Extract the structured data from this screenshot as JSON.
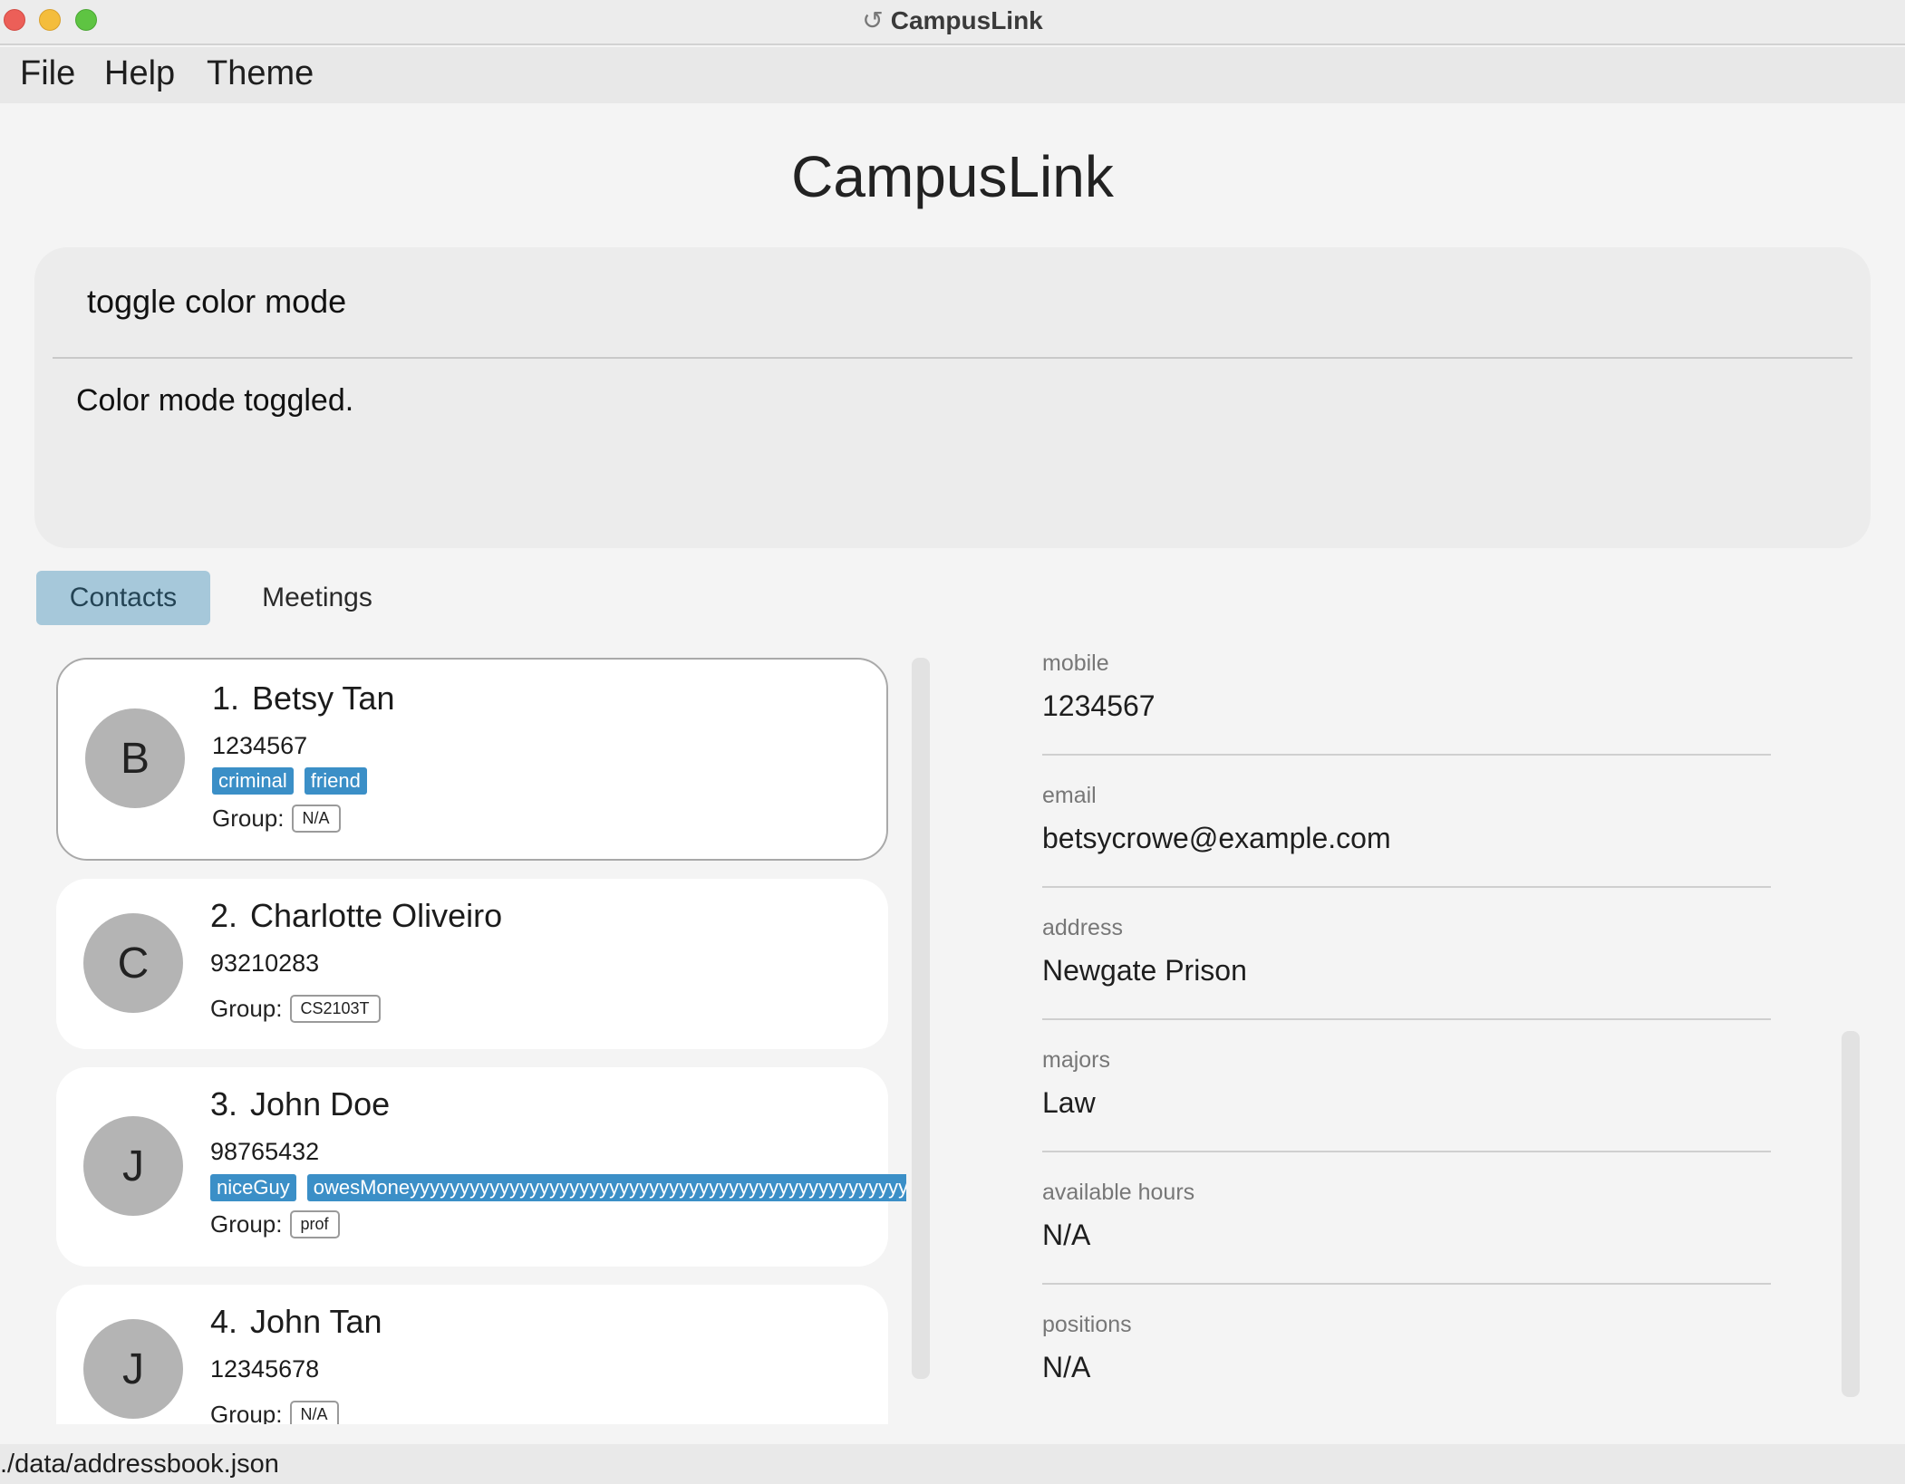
{
  "window": {
    "title": "CampusLink",
    "app_icon": "campuslink-icon"
  },
  "menubar": {
    "items": [
      "File",
      "Help",
      "Theme"
    ]
  },
  "app": {
    "heading": "CampusLink"
  },
  "command": {
    "input_value": "toggle color mode",
    "result": "Color mode toggled."
  },
  "tabs": [
    {
      "label": "Contacts",
      "active": true
    },
    {
      "label": "Meetings",
      "active": false
    }
  ],
  "contacts": [
    {
      "index": "1.",
      "name": "Betsy Tan",
      "initial": "B",
      "phone": "1234567",
      "tags": [
        "criminal",
        "friend"
      ],
      "group_label": "Group:",
      "group": "N/A"
    },
    {
      "index": "2.",
      "name": "Charlotte Oliveiro",
      "initial": "C",
      "phone": "93210283",
      "tags": [],
      "group_label": "Group:",
      "group": "CS2103T"
    },
    {
      "index": "3.",
      "name": "John Doe",
      "initial": "J",
      "phone": "98765432",
      "tags": [
        "niceGuy",
        "owesMoneyyyyyyyyyyyyyyyyyyyyyyyyyyyyyyyyyyyyyyyyyyyyyyyyyy"
      ],
      "group_label": "Group:",
      "group": "prof"
    },
    {
      "index": "4.",
      "name": "John Tan",
      "initial": "J",
      "phone": "12345678",
      "tags": [],
      "group_label": "Group:",
      "group": "N/A"
    }
  ],
  "details": [
    {
      "label": "mobile",
      "value": "1234567"
    },
    {
      "label": "email",
      "value": "betsycrowe@example.com"
    },
    {
      "label": "address",
      "value": "Newgate Prison"
    },
    {
      "label": "majors",
      "value": "Law"
    },
    {
      "label": "available hours",
      "value": "N/A"
    },
    {
      "label": "positions",
      "value": "N/A"
    }
  ],
  "statusbar": {
    "path": "./data/addressbook.json"
  },
  "colors": {
    "accent_tag": "#3b8fc7",
    "active_tab": "#a6c8da",
    "avatar": "#b4b4b4"
  }
}
